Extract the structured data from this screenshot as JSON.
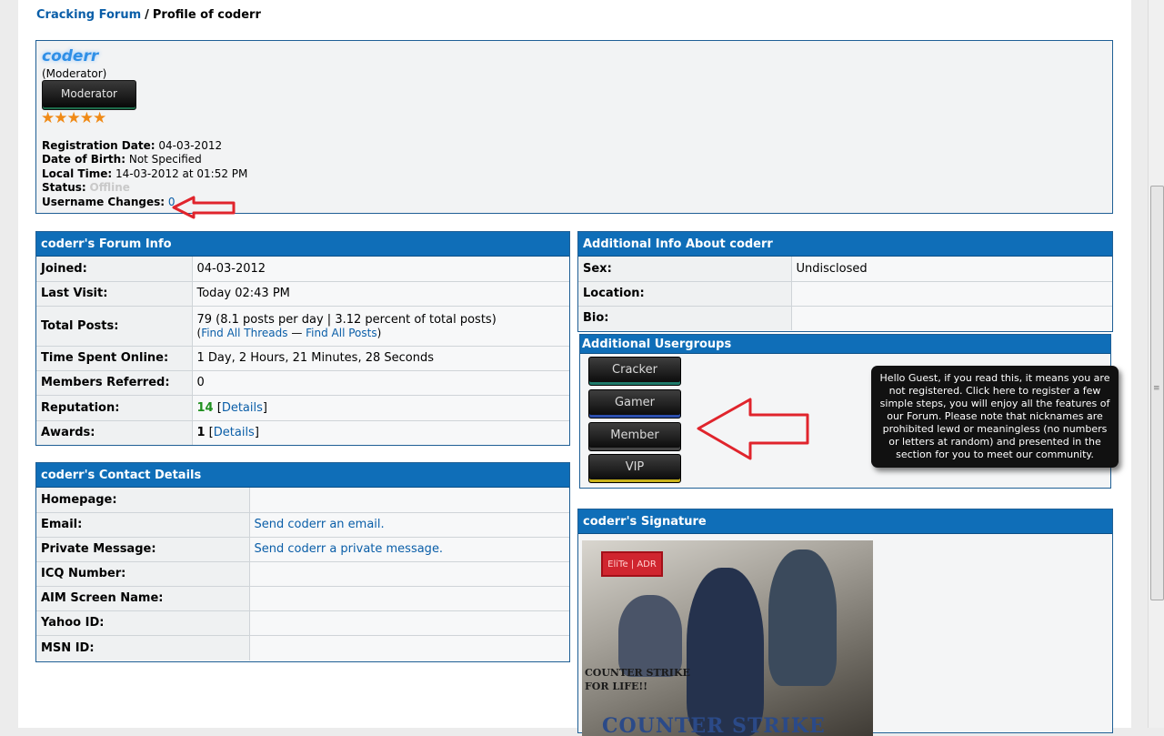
{
  "breadcrumb": {
    "forum": "Cracking Forum",
    "separator": "/",
    "current": "Profile of coderr"
  },
  "profile": {
    "username": "coderr",
    "usertitle": "(Moderator)",
    "rank_image_label": "Moderator",
    "stars": "★★★★★",
    "fields": {
      "registration_label": "Registration Date:",
      "registration_value": "04-03-2012",
      "dob_label": "Date of Birth:",
      "dob_value": "Not Specified",
      "localtime_label": "Local Time:",
      "localtime_value": "14-03-2012 at 01:52 PM",
      "status_label": "Status:",
      "status_value": "Offline",
      "username_changes_label": "Username Changes:",
      "username_changes_value": "0"
    }
  },
  "forum_info": {
    "header": "coderr's Forum Info",
    "joined_label": "Joined:",
    "joined_value": "04-03-2012",
    "last_visit_label": "Last Visit:",
    "last_visit_value": "Today 02:43 PM",
    "total_posts_label": "Total Posts:",
    "total_posts_value": "79 (8.1 posts per day | 3.12 percent of total posts)",
    "find_threads": "Find All Threads",
    "find_sep": "—",
    "find_posts": "Find All Posts",
    "time_online_label": "Time Spent Online:",
    "time_online_value": "1 Day, 2 Hours, 21 Minutes, 28 Seconds",
    "referred_label": "Members Referred:",
    "referred_value": "0",
    "reputation_label": "Reputation:",
    "reputation_value": "14",
    "reputation_details": "Details",
    "awards_label": "Awards:",
    "awards_value": "1",
    "awards_details": "Details"
  },
  "contact": {
    "header": "coderr's Contact Details",
    "homepage_label": "Homepage:",
    "homepage_value": "",
    "email_label": "Email:",
    "email_value": "Send coderr an email.",
    "pm_label": "Private Message:",
    "pm_value": "Send coderr a private message.",
    "icq_label": "ICQ Number:",
    "icq_value": "",
    "aim_label": "AIM Screen Name:",
    "aim_value": "",
    "yahoo_label": "Yahoo ID:",
    "yahoo_value": "",
    "msn_label": "MSN ID:",
    "msn_value": ""
  },
  "additional": {
    "header": "Additional Info About coderr",
    "sex_label": "Sex:",
    "sex_value": "Undisclosed",
    "location_label": "Location:",
    "location_value": "",
    "bio_label": "Bio:",
    "bio_value": ""
  },
  "usergroups": {
    "header": "Additional Usergroups",
    "groups": [
      "Cracker",
      "Gamer",
      "Member",
      "VIP"
    ],
    "accents": [
      "#1e7a6a",
      "#2c4fae",
      "#444444",
      "#c9b21a"
    ]
  },
  "tooltip": {
    "text": "Hello Guest, if you read this, it means you are not registered. Click here to register a few simple steps, you will enjoy all the features of our Forum. Please note that nicknames are prohibited lewd or meaningless (no numbers or letters at random) and presented in the section for you to meet our community."
  },
  "signature": {
    "header": "coderr's Signature",
    "tag_text": "EliTe | ADR",
    "caption_line1": "COUNTER STRIKE",
    "caption_line2": "FOR LIFE!!",
    "logo_text": "COUNTER STRIKE"
  },
  "colors": {
    "header_bg": "#0f6eb8",
    "link": "#0a5ea8",
    "reputation": "#1f8f1f",
    "arrow": "#e0242c"
  }
}
